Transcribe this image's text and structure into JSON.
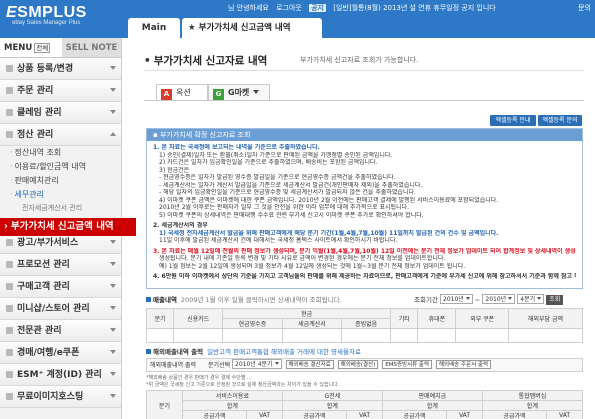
{
  "header": {
    "brand": "ESMPLUS",
    "brand_sub": "ebay Sales Manager Plus",
    "user_text": "님 안녕하세요",
    "logout": "로그아웃",
    "notice_badge": "공지",
    "notice_text": "[일반]월통(8월) 2013년 설 연휴 휴무일정 공지 입니다",
    "right_text": "문의"
  },
  "tabs": {
    "main": "Main",
    "active": "부가가치세 신고금액 내역"
  },
  "sidebar": {
    "menu_label": "MENU",
    "menu_all": "전체",
    "sell_note": "SELL NOTE",
    "items": [
      {
        "label": "상품 등록/변경"
      },
      {
        "label": "주문 관리"
      },
      {
        "label": "클레임 관리"
      },
      {
        "label": "정산 관리"
      }
    ],
    "subs": [
      {
        "label": "정산내역 조회"
      },
      {
        "label": "이용료/할인금액 내역"
      },
      {
        "label": "판매예치관리"
      },
      {
        "label": "세무관리"
      }
    ],
    "subsub": "전자세금계산서 관리",
    "active": "부가가치세 신고금액 내역",
    "items_after": [
      {
        "label": "광고/부가서비스"
      },
      {
        "label": "프로모션 관리"
      },
      {
        "label": "구매고객 관리"
      },
      {
        "label": "미니샵/스토어 관리"
      },
      {
        "label": "전문관 관리"
      },
      {
        "label": "경매/여행/e쿠폰"
      },
      {
        "label": "ESM⁺ 계정(ID) 관리"
      },
      {
        "label": "무료이미지호스팅"
      }
    ]
  },
  "page": {
    "title": "부가가치세 신고자료 내역",
    "desc": "부가가치세 신고자료 조회가 가능합니다.",
    "market_tabs": [
      {
        "logo": "A",
        "label": "옥션"
      },
      {
        "logo": "G",
        "label": "G마켓"
      }
    ],
    "btn_guide": "엑셀등록 안내",
    "btn_faq": "엑셀등록 문의"
  },
  "notice": {
    "head": "부가가치세 확정 신고자료 조회",
    "lines": [
      "1. 본 자료는 국세청에 보고되는 내역을 기준으로 추출하였습니다.",
      "1) 승인(결제)일자 또는 환불(취소)일자 기준으로 판매된 금액을 가맹점별 승인된 금액입니다.",
      "2) 카드건은 일자가 입금확인일을 기준으로 추출하였으며, 배송비는 포함된 금액입니다.",
      "3) 현금건은",
      "- 현금영수증은 일자가 발급된 영수증 발급일을 기준으로 현금영수증 금액건을 추출하였습니다.",
      "- 세금계산서는 일자가 계산서 발급일을 기준으로 세금계산서 발급건(개인판매자 제외)을 추출하였습니다.",
      "- 해당 일자의 입금확인일을 기준으로 현금영수증 및 세금계산서가 발급되지 않은 건을 추출하였습니다.",
      "4) 이마켓 쿠폰 금액은 이마켓에 대한 쿠폰 금액입니다. 2010년 2월 이전에는 판매고객 결제에 발행된 서비스이용료에 포함되었습니다.",
      "2010년 2월 이후로는 판매자가 일부 그 것을 안전을 위한 이러 업무에 대해 추가적으로 표시됩니다.",
      "5) 이마켓 쿠폰의 상세내역은 판매대행 수수료 관련 부가세 신고시 이마켓 쿠폰 추가로 확인하셔야 합니다.",
      "2. 세금계산서의 경우",
      "1) 국세청 전자세금계산서 발급을 위해 판매고객에게 해당 분기 기간(1월,4월,7월,10월) 11일까지 발급된 건의 건수 및 금액입니다.",
      "11일 이후에 발급된 세금계산서 건에 대해서는 국세청 홈택스 사이트에서 확인하시기 바랍니다.",
      "3. 본 자료는 매월 12일에 전월의 판매 정보가 생성되며, 분기 익월(1월,4월,7월,10월) 12일 이전에는 분기 전체 정보가 업데이트 되어 합계정보 및 상세내역이 생성됩니다.",
      "생성됩니다. 분기 내에 기존일 등록 변경 및 기타 사유로 금액이 변경된 경우에는 분기 전체 정보를 업데이트합니다.",
      "예) 1월 정보는 2월 12일에 생성되며 3월 정보가 4월 12일에 생성되는 것에 1월~3월 분기 전체 정보가 업데이트 됩니다.",
      "4. 6만원 이하 이마켓에서 상단의 기준을 가지고 고객님들의 판매를 위해 제공하는 자료이므로, 판매고객에게 기준에 부가세 신고에 위해 참고하셔서 기준과 함께 참고 하시기 바랍니다."
    ]
  },
  "filter1": {
    "label": "매출내역",
    "desc": "2009년 1월 이후 일월 클릭하시면 상세내역이 조회됩니다.",
    "year_label": "조회기간",
    "year1": "2010년",
    "q1": "~",
    "year2": "2010년",
    "q2": "4분기",
    "go": "조회"
  },
  "table1": {
    "headers": [
      "분기",
      "신용카드",
      "현금",
      "기타",
      "휴대폰",
      "외부 쿠폰",
      "해외부담 금액"
    ],
    "sub_headers": [
      "현금영수증",
      "세금계산서",
      "증빙없음"
    ]
  },
  "section2": {
    "label": "해외매출내역 출력",
    "desc": "일반고객 판매고객통합 해외매출 거래에 대한 영세율자료"
  },
  "filter2": {
    "label": "해외매출내역 출력",
    "period": "분기선택",
    "period_val": "2010년 4분기",
    "btns": [
      "해외배송 결산자료",
      "해외배송(결산)",
      "EMS증빙서류 출력",
      "해외배송 주문서 출력"
    ]
  },
  "footnote": [
    "*해외배송 상품인 경우 판매가 경우 결제 수단별 ...",
    "*위 금액은 국세청 신고 기준으로 산정된 것으로 실제 정산금액과는 차이가 있을 수 있습니다."
  ],
  "table2": {
    "headers": [
      "분기",
      "서비스이용료",
      "G전세",
      "판매예치금",
      "통합멤버십"
    ],
    "sub": [
      "공급가액",
      "VAT",
      "합계"
    ],
    "sub2": [
      "공급가액",
      "VAT",
      "공급가액",
      "VAT",
      "공급가액",
      "VAT",
      "공급가액",
      "VAT"
    ]
  }
}
